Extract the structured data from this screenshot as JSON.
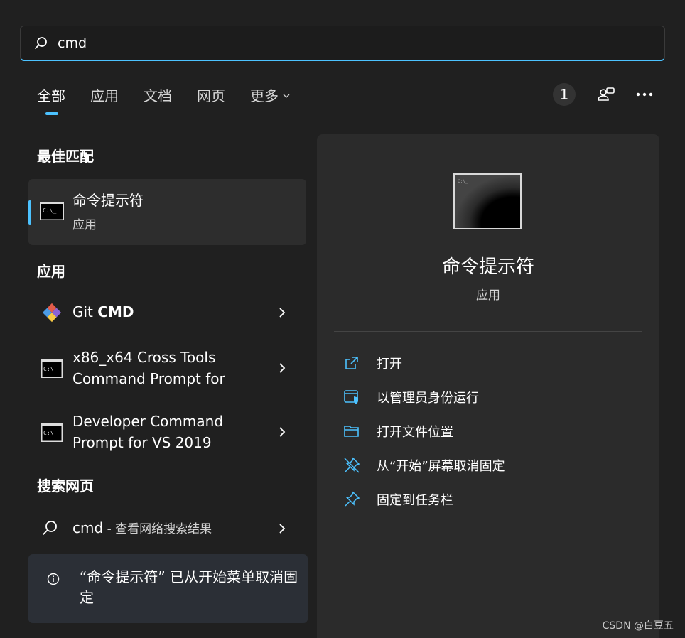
{
  "search": {
    "value": "cmd"
  },
  "tabs": [
    {
      "label": "全部"
    },
    {
      "label": "应用"
    },
    {
      "label": "文档"
    },
    {
      "label": "网页"
    },
    {
      "label": "更多"
    }
  ],
  "top_right": {
    "badge_count": "1"
  },
  "best_match": {
    "section_title": "最佳匹配",
    "title": "命令提示符",
    "subtitle": "应用"
  },
  "apps": {
    "section_title": "应用",
    "items": [
      {
        "title_prefix": "Git ",
        "title_bold": "CMD"
      },
      {
        "line1": "x86_x64 Cross Tools",
        "line2": "Command Prompt for"
      },
      {
        "line1": "Developer Command",
        "line2": "Prompt for VS 2019"
      }
    ]
  },
  "web": {
    "section_title": "搜索网页",
    "query": "cmd",
    "suffix": " - 查看网络搜索结果"
  },
  "notice": {
    "text": "“命令提示符” 已从开始菜单取消固定"
  },
  "panel": {
    "title": "命令提示符",
    "type": "应用",
    "actions": [
      {
        "label": "打开",
        "icon": "open-external-icon"
      },
      {
        "label": "以管理员身份运行",
        "icon": "shield-admin-icon"
      },
      {
        "label": "打开文件位置",
        "icon": "folder-icon"
      },
      {
        "label": "从“开始”屏幕取消固定",
        "icon": "unpin-icon"
      },
      {
        "label": "固定到任务栏",
        "icon": "pin-icon"
      }
    ]
  },
  "watermark": "CSDN @白豆五",
  "colors": {
    "accent": "#4cc2ff",
    "background": "#202020",
    "panel": "#2b2b2b"
  }
}
